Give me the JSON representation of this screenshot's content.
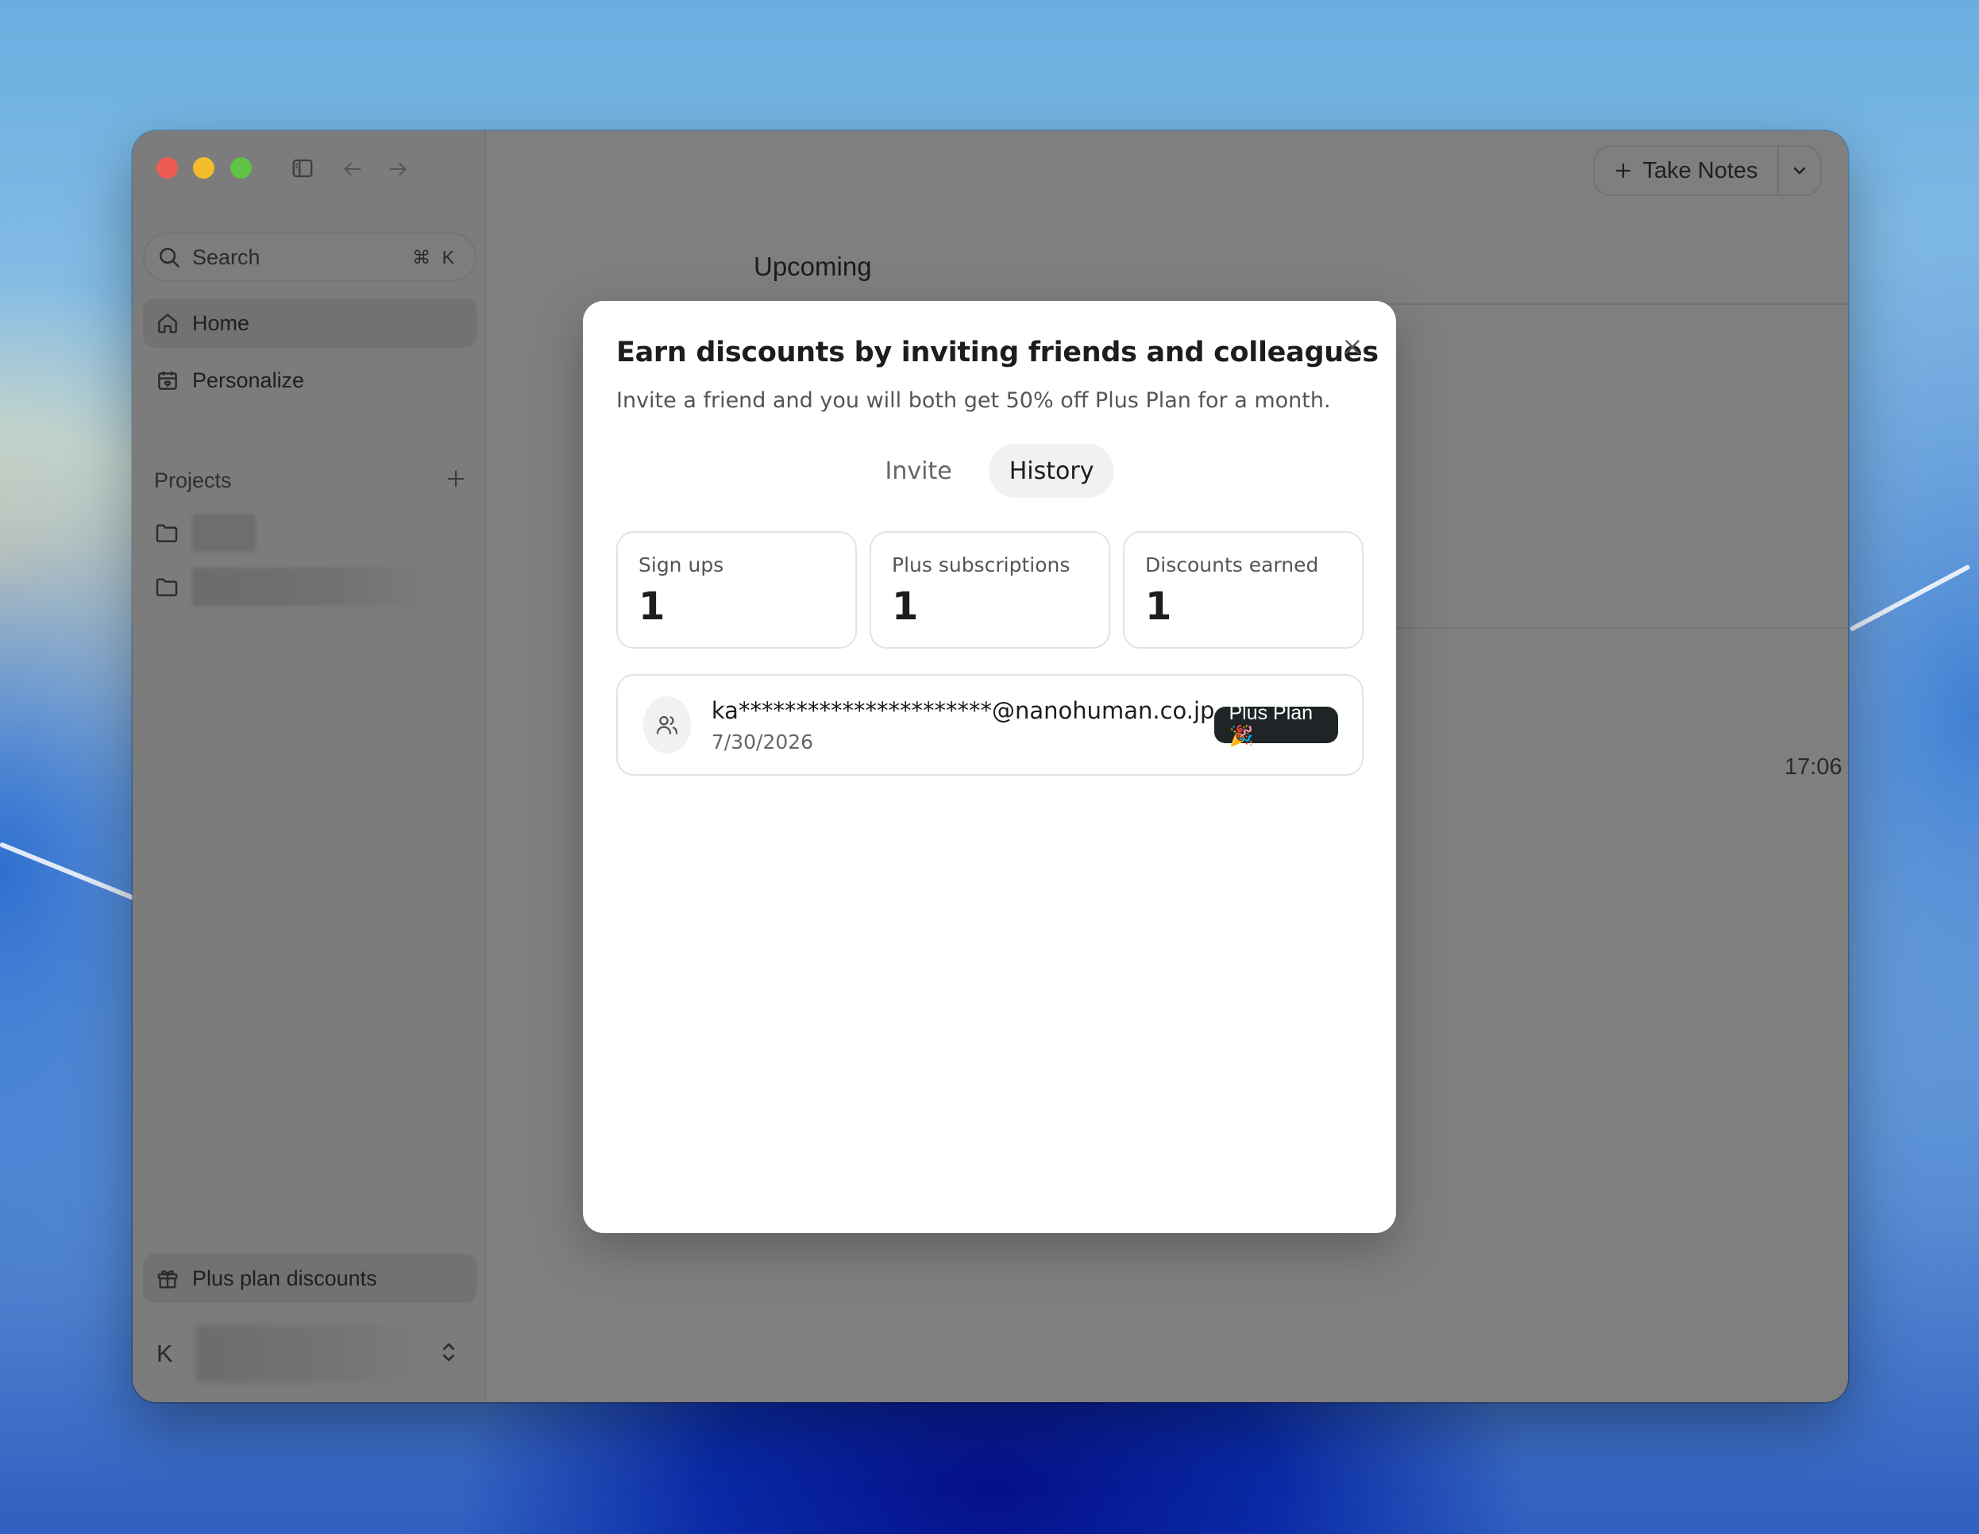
{
  "window": {
    "toolbar": {
      "take_notes_label": "Take Notes"
    }
  },
  "sidebar": {
    "search": {
      "label": "Search",
      "shortcut": "⌘ K"
    },
    "nav": [
      {
        "label": "Home",
        "icon": "home-icon",
        "active": true
      },
      {
        "label": "Personalize",
        "icon": "calendar-heart-icon",
        "active": false
      }
    ],
    "projects": {
      "title": "Projects"
    },
    "plus_discounts_label": "Plus plan discounts",
    "user_initial": "K"
  },
  "main": {
    "section_title": "Upcoming",
    "time": "17:06"
  },
  "modal": {
    "title": "Earn discounts by inviting friends and colleagues",
    "subtitle": "Invite a friend and you will both get 50% off Plus Plan for a month.",
    "tabs": [
      {
        "label": "Invite",
        "active": false
      },
      {
        "label": "History",
        "active": true
      }
    ],
    "stats": [
      {
        "label": "Sign ups",
        "value": "1"
      },
      {
        "label": "Plus subscriptions",
        "value": "1"
      },
      {
        "label": "Discounts earned",
        "value": "1"
      }
    ],
    "history": [
      {
        "email": "ka**********************@nanohuman.co.jp",
        "date": "7/30/2026",
        "badge": "Plus Plan 🎉"
      }
    ]
  },
  "colors": {
    "traffic_red": "#ee5b52",
    "traffic_yellow": "#f4bd2e",
    "traffic_green": "#5fc345",
    "badge_bg": "#1f2426"
  }
}
